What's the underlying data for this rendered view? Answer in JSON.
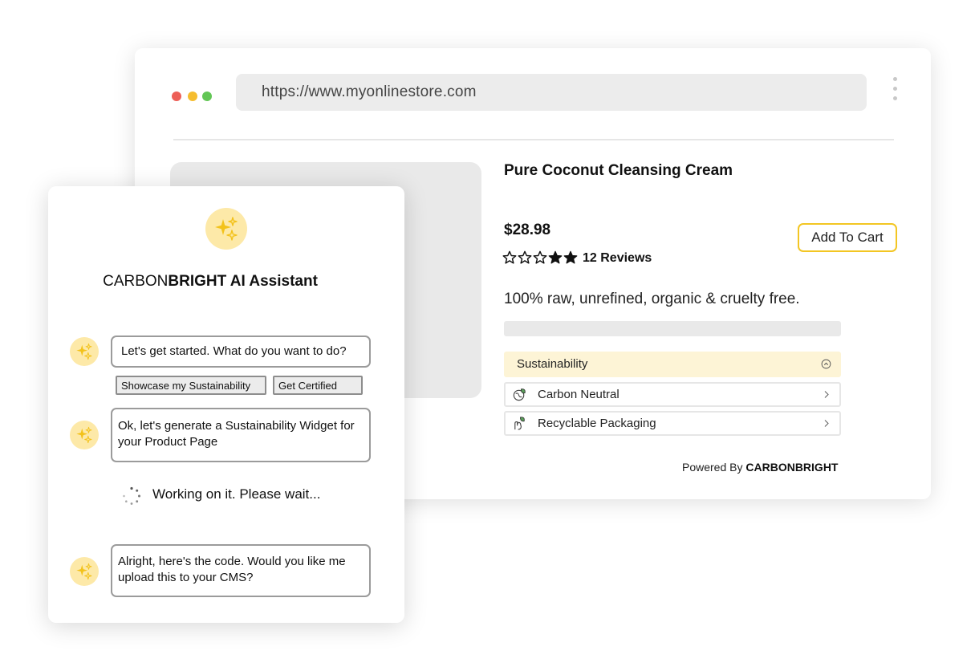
{
  "browser": {
    "url": "https://www.myonlinestore.com",
    "traffic_light_colors": {
      "close": "#ed5f57",
      "minimize": "#f5bd2f",
      "maximize": "#62c655"
    }
  },
  "product": {
    "title": "Pure Coconut Cleansing Cream",
    "price": "$28.98",
    "add_to_cart_label": "Add To Cart",
    "rating": {
      "filled_stars": 2,
      "total_stars": 5
    },
    "reviews_label": "12 Reviews",
    "description": "100% raw, unrefined, organic & cruelty free."
  },
  "sustainability": {
    "header": "Sustainability",
    "items": [
      {
        "label": "Carbon Neutral",
        "icon": "leaf-globe-icon"
      },
      {
        "label": "Recyclable Packaging",
        "icon": "hand-leaf-icon"
      }
    ],
    "powered_by_prefix": "Powered By",
    "powered_by_brand": "CARBONBRIGHT"
  },
  "assistant": {
    "title_prefix": "CARBON",
    "title_bold": "BRIGHT AI Assistant",
    "accent_color": "#f3c623",
    "messages": [
      "Let's get started. What do you want to do?",
      "Ok, let's generate a Sustainability Widget for your Product Page",
      "Alright, here's the code. Would you like me upload this to your CMS?"
    ],
    "options": [
      "Showcase my Sustainability",
      "Get Certified"
    ],
    "working_text": "Working on it. Please wait..."
  }
}
